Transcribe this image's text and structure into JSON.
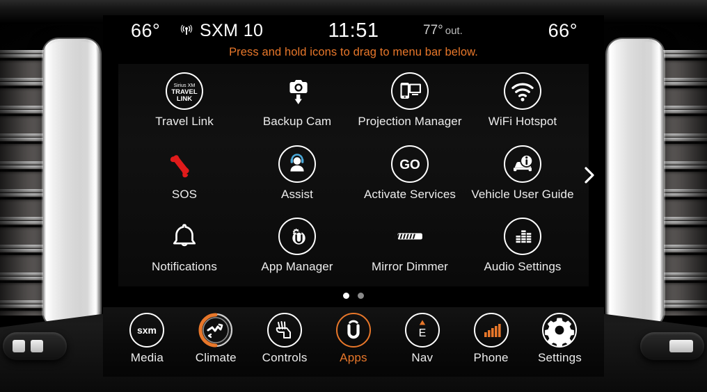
{
  "status_bar": {
    "left_temp": "66°",
    "radio_icon": "broadcast-antenna-icon",
    "radio_source": "SXM 10",
    "clock": "11:51",
    "outside_temp": "77°",
    "outside_suffix": "out.",
    "right_temp": "66°"
  },
  "banner": {
    "message": "Press and hold icons to drag to menu bar below."
  },
  "apps": {
    "page_indicator": {
      "total": 2,
      "current": 1
    },
    "next_page_icon": "chevron-right-icon",
    "items": [
      {
        "label": "Travel Link",
        "icon": "sirius-xm-travel-link-icon",
        "badge_lines": [
          "Sirius XM",
          "TRAVEL",
          "LINK"
        ]
      },
      {
        "label": "Backup Cam",
        "icon": "camera-down-arrow-icon"
      },
      {
        "label": "Projection Manager",
        "icon": "phone-screen-projection-icon"
      },
      {
        "label": "WiFi Hotspot",
        "icon": "wifi-icon"
      },
      {
        "label": "SOS",
        "icon": "red-phone-handset-icon"
      },
      {
        "label": "Assist",
        "icon": "headset-agent-icon"
      },
      {
        "label": "Activate Services",
        "icon": "go-badge-icon",
        "badge_text": "GO"
      },
      {
        "label": "Vehicle User Guide",
        "icon": "car-info-icon"
      },
      {
        "label": "Notifications",
        "icon": "bell-icon"
      },
      {
        "label": "App Manager",
        "icon": "uconnect-gear-icon"
      },
      {
        "label": "Mirror Dimmer",
        "icon": "mirror-dimmer-icon"
      },
      {
        "label": "Audio Settings",
        "icon": "equalizer-bars-icon"
      }
    ]
  },
  "menu_bar": {
    "items": [
      {
        "label": "Media",
        "icon": "sxm-logo-icon",
        "badge_text": "sxm",
        "active": false
      },
      {
        "label": "Climate",
        "icon": "climate-fan-icon",
        "active": false
      },
      {
        "label": "Controls",
        "icon": "vehicle-controls-icon",
        "active": false
      },
      {
        "label": "Apps",
        "icon": "uconnect-u-icon",
        "active": true
      },
      {
        "label": "Nav",
        "icon": "compass-east-icon",
        "badge_text": "E",
        "active": false
      },
      {
        "label": "Phone",
        "icon": "signal-bars-icon",
        "active": false
      },
      {
        "label": "Settings",
        "icon": "gear-icon",
        "active": false
      }
    ]
  },
  "colors": {
    "accent_orange": "#e8772a",
    "sos_red": "#e01b1b",
    "text_white": "#ededed",
    "screen_black": "#000000"
  }
}
